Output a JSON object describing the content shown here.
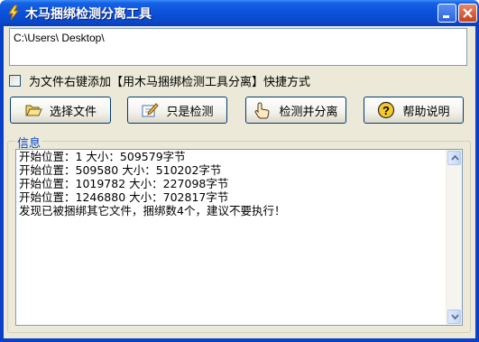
{
  "window": {
    "title": "木马捆绑检测分离工具"
  },
  "path_field": {
    "value": "C:\\Users\\          Desktop\\"
  },
  "options": {
    "context_menu_label": "为文件右键添加【用木马捆绑检测工具分离】快捷方式",
    "checked": false
  },
  "buttons": {
    "select_file": "选择文件",
    "detect_only": "只是检测",
    "detect_and_split": "检测并分离",
    "help": "帮助说明"
  },
  "info": {
    "group_title": "信息",
    "lines": [
      "开始位置：1 大小：509579字节",
      "开始位置：509580 大小：510202字节",
      "开始位置：1019782 大小：227098字节",
      "开始位置：1246880 大小：702817字节",
      "发现已被捆绑其它文件，捆绑数4个，建议不要执行！"
    ]
  },
  "icons": {
    "app": "lightning-icon",
    "select_file": "folder-open-icon",
    "detect_only": "pencil-icon",
    "detect_and_split": "hand-pointer-icon",
    "help": "help-icon"
  }
}
